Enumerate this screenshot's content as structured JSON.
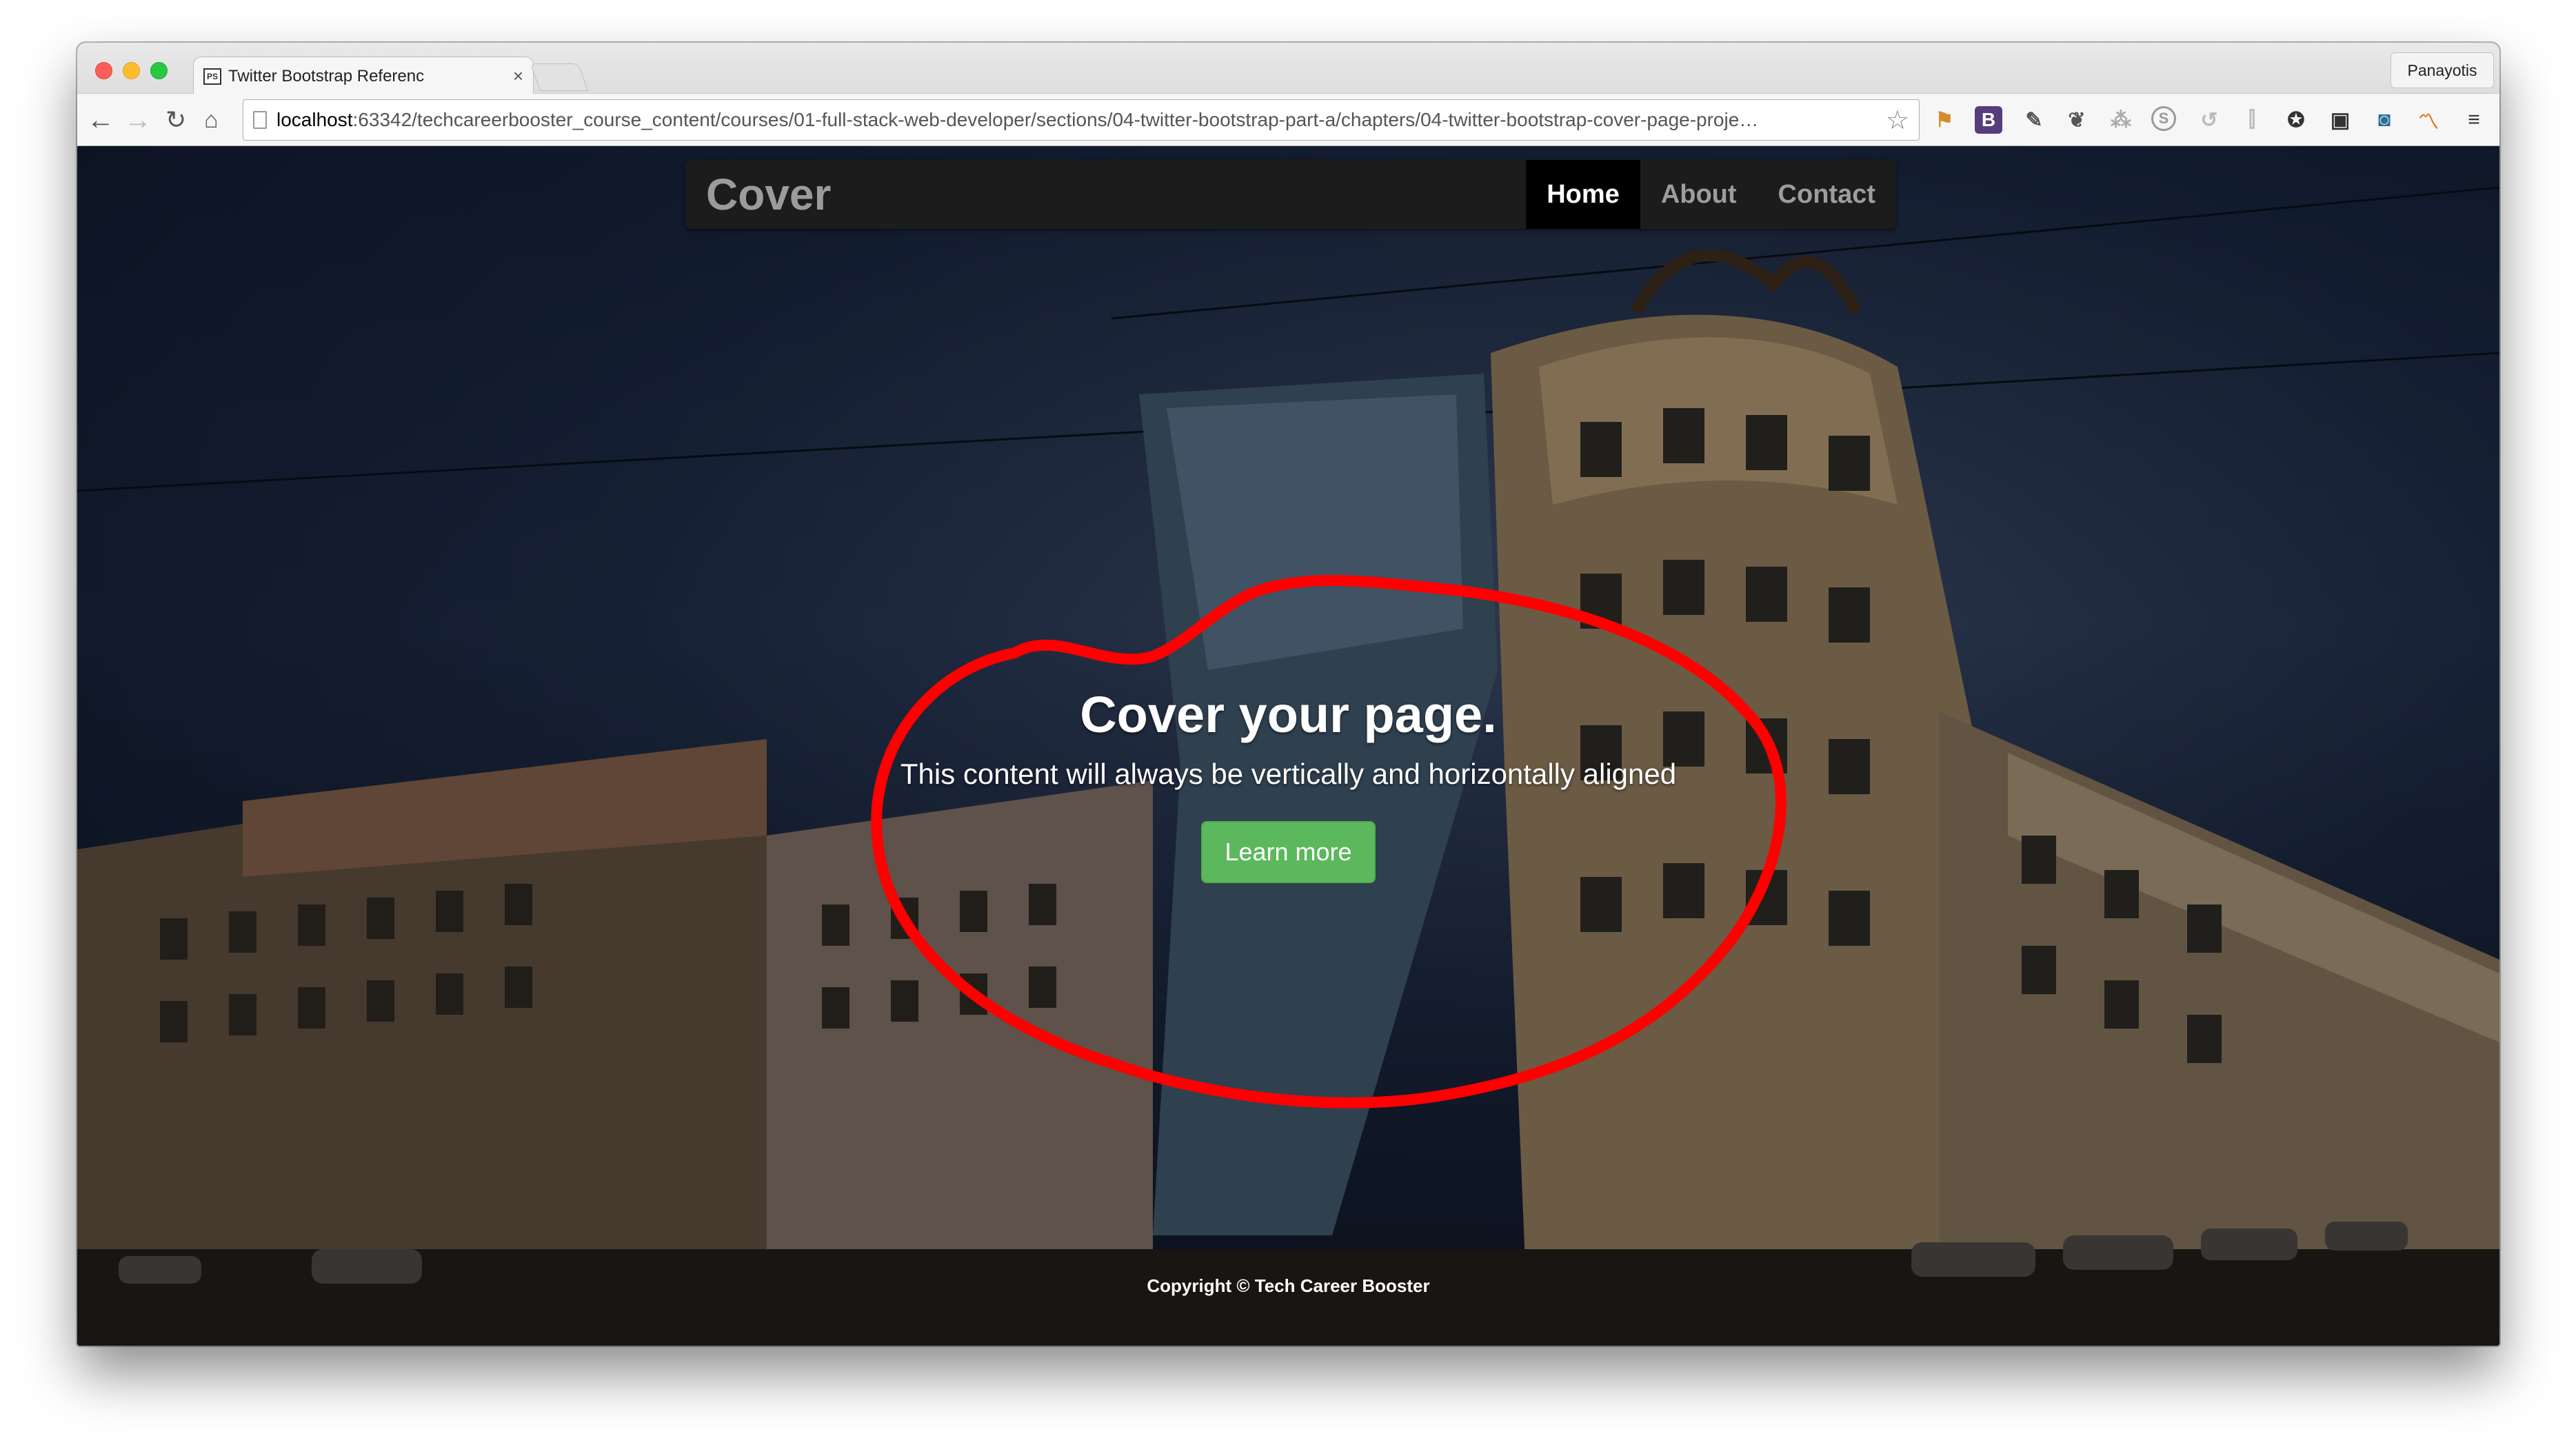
{
  "browser": {
    "tab_title": "Twitter Bootstrap Referenc",
    "tab_close": "×",
    "tab_favicon": "PS",
    "profile_name": "Panayotis",
    "url_host": "localhost",
    "url_rest": ":63342/techcareerbooster_course_content/courses/01-full-stack-web-developer/sections/04-twitter-bootstrap-part-a/chapters/04-twitter-bootstrap-cover-page-proje…",
    "nav_icons": [
      "back-arrow-icon",
      "forward-arrow-icon",
      "reload-icon",
      "home-icon"
    ],
    "extension_icons": [
      "star-icon",
      "bookmark-flag-icon",
      "bootstrap-b-icon",
      "eyedropper-icon",
      "evernote-icon",
      "translate-icon",
      "skype-icon",
      "sync-icon",
      "readability-icon",
      "aperture-icon",
      "window-icon",
      "lock-icon",
      "analytics-icon",
      "menu-icon"
    ],
    "ext_bootstrap_label": "B",
    "ext_skype_label": "S"
  },
  "page": {
    "brand": "Cover",
    "nav": [
      {
        "label": "Home",
        "active": true
      },
      {
        "label": "About",
        "active": false
      },
      {
        "label": "Contact",
        "active": false
      }
    ],
    "heading": "Cover your page.",
    "lead": "This content will always be vertically and horizontally aligned",
    "button_label": "Learn more",
    "footer": "Copyright © Tech Career Booster"
  },
  "colors": {
    "annotation": "#ff0000",
    "button": "#5cb85c",
    "masthead": "#1c1c1c"
  }
}
